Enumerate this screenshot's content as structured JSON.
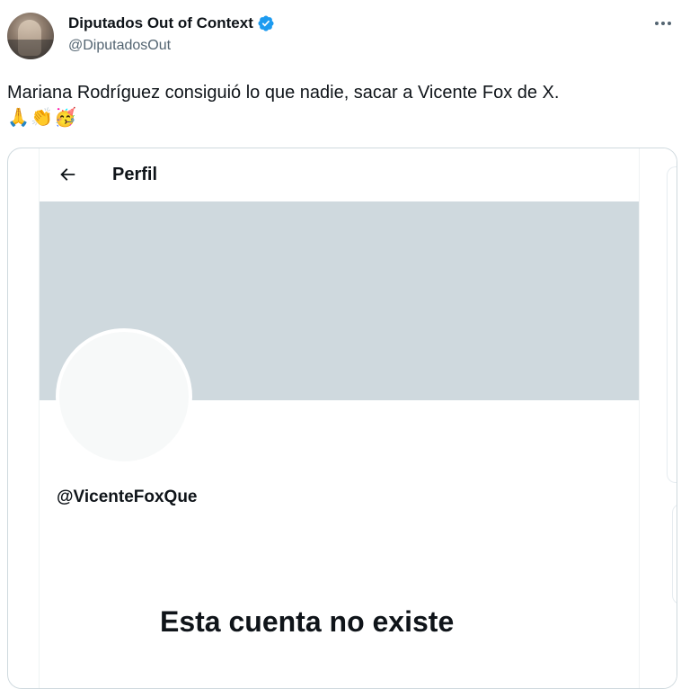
{
  "tweet": {
    "author": {
      "display_name": "Diputados Out of Context",
      "handle": "@DiputadosOut",
      "verified": true,
      "verified_color": "#1d9bf0"
    },
    "text": "Mariana Rodríguez consiguió lo que nadie, sacar a Vicente Fox de X.",
    "emojis": [
      "🙏",
      "👏",
      "🥳"
    ],
    "more_icon": "more-horizontal-icon"
  },
  "media": {
    "header_title": "Perfil",
    "back_icon": "arrow-left-icon",
    "profile_handle": "@VicenteFoxQue",
    "message": "Esta cuenta no existe",
    "banner_color": "#cfd9de"
  }
}
